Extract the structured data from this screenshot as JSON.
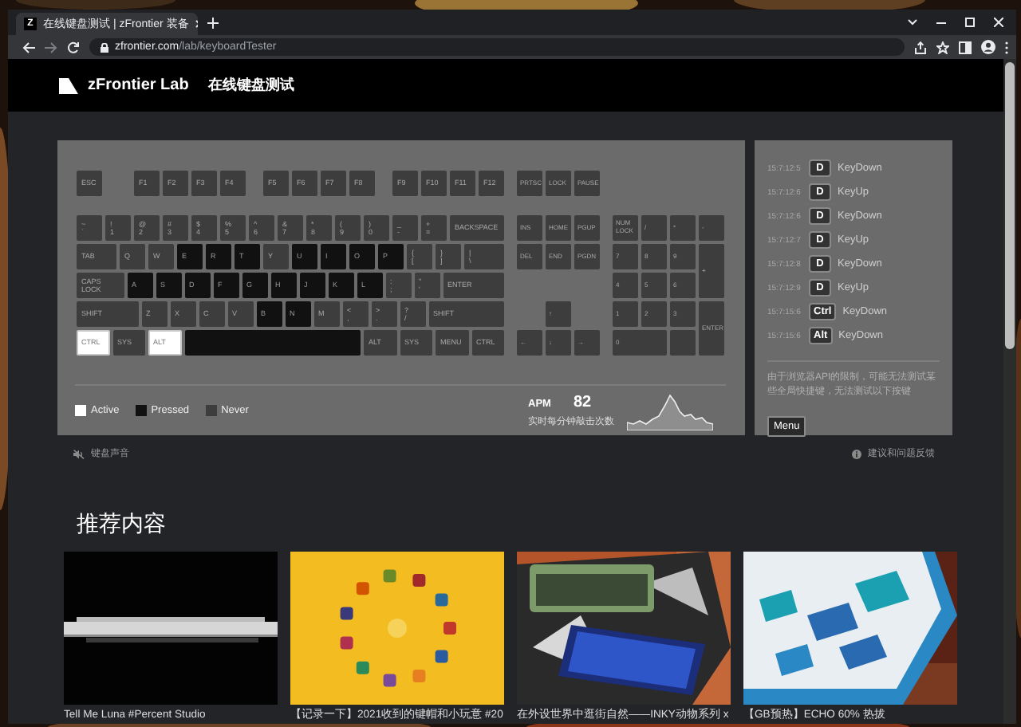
{
  "browser": {
    "favicon": "Z",
    "tab_title": "在线键盘测试 | zFrontier 装备",
    "url_domain": "zfrontier.com",
    "url_path": "/lab/keyboardTester"
  },
  "header": {
    "brand": "zFrontier Lab",
    "title": "在线键盘测试"
  },
  "keyboard": {
    "function_row": [
      {
        "label": "ESC",
        "active": false,
        "pressed": false
      },
      {
        "label": "F1",
        "active": false,
        "pressed": false
      },
      {
        "label": "F2",
        "active": false,
        "pressed": false
      },
      {
        "label": "F3",
        "active": false,
        "pressed": false
      },
      {
        "label": "F4",
        "active": false,
        "pressed": false
      },
      {
        "label": "F5",
        "active": false,
        "pressed": false
      },
      {
        "label": "F6",
        "active": false,
        "pressed": false
      },
      {
        "label": "F7",
        "active": false,
        "pressed": false
      },
      {
        "label": "F8",
        "active": false,
        "pressed": false
      },
      {
        "label": "F9",
        "active": false,
        "pressed": false
      },
      {
        "label": "F10",
        "active": false,
        "pressed": false
      },
      {
        "label": "F11",
        "active": false,
        "pressed": false
      },
      {
        "label": "F12",
        "active": false,
        "pressed": false
      }
    ],
    "system_keys": [
      {
        "label": "PRTSC",
        "active": false,
        "pressed": false
      },
      {
        "label": "LOCK",
        "active": false,
        "pressed": false
      },
      {
        "label": "PAUSE",
        "active": false,
        "pressed": false
      }
    ],
    "main_rows": [
      [
        {
          "label": "~\n`",
          "active": false,
          "pressed": false
        },
        {
          "label": "!\n1",
          "active": false,
          "pressed": false
        },
        {
          "label": "@\n2",
          "active": false,
          "pressed": false
        },
        {
          "label": "#\n3",
          "active": false,
          "pressed": false
        },
        {
          "label": "$\n4",
          "active": false,
          "pressed": false
        },
        {
          "label": "%\n5",
          "active": false,
          "pressed": false
        },
        {
          "label": "^\n6",
          "active": false,
          "pressed": false
        },
        {
          "label": "&\n7",
          "active": false,
          "pressed": false
        },
        {
          "label": "*\n8",
          "active": false,
          "pressed": false
        },
        {
          "label": "(\n9",
          "active": false,
          "pressed": false
        },
        {
          "label": ")\n0",
          "active": false,
          "pressed": false
        },
        {
          "label": "_\n-",
          "active": false,
          "pressed": false
        },
        {
          "label": "+\n=",
          "active": false,
          "pressed": false
        },
        {
          "label": "BACKSPACE",
          "active": false,
          "pressed": false
        }
      ],
      [
        {
          "label": "TAB",
          "active": false,
          "pressed": false
        },
        {
          "label": "Q",
          "active": false,
          "pressed": false
        },
        {
          "label": "W",
          "active": false,
          "pressed": false
        },
        {
          "label": "E",
          "active": false,
          "pressed": true
        },
        {
          "label": "R",
          "active": false,
          "pressed": true
        },
        {
          "label": "T",
          "active": false,
          "pressed": true
        },
        {
          "label": "Y",
          "active": false,
          "pressed": false
        },
        {
          "label": "U",
          "active": false,
          "pressed": true
        },
        {
          "label": "I",
          "active": false,
          "pressed": true
        },
        {
          "label": "O",
          "active": false,
          "pressed": true
        },
        {
          "label": "P",
          "active": false,
          "pressed": true
        },
        {
          "label": "{\n[",
          "active": false,
          "pressed": false
        },
        {
          "label": "}\n]",
          "active": false,
          "pressed": false
        },
        {
          "label": "|\n\\",
          "active": false,
          "pressed": false
        }
      ],
      [
        {
          "label": "CAPS LOCK",
          "active": false,
          "pressed": false
        },
        {
          "label": "A",
          "active": false,
          "pressed": true
        },
        {
          "label": "S",
          "active": false,
          "pressed": true
        },
        {
          "label": "D",
          "active": false,
          "pressed": true
        },
        {
          "label": "F",
          "active": false,
          "pressed": true
        },
        {
          "label": "G",
          "active": false,
          "pressed": true
        },
        {
          "label": "H",
          "active": false,
          "pressed": true
        },
        {
          "label": "J",
          "active": false,
          "pressed": true
        },
        {
          "label": "K",
          "active": false,
          "pressed": true
        },
        {
          "label": "L",
          "active": false,
          "pressed": true
        },
        {
          "label": ":\n;",
          "active": false,
          "pressed": false
        },
        {
          "label": "\"\n'",
          "active": false,
          "pressed": false
        },
        {
          "label": "ENTER",
          "active": false,
          "pressed": false
        }
      ],
      [
        {
          "label": "SHIFT",
          "active": false,
          "pressed": false
        },
        {
          "label": "Z",
          "active": false,
          "pressed": false
        },
        {
          "label": "X",
          "active": false,
          "pressed": false
        },
        {
          "label": "C",
          "active": false,
          "pressed": false
        },
        {
          "label": "V",
          "active": false,
          "pressed": false
        },
        {
          "label": "B",
          "active": false,
          "pressed": true
        },
        {
          "label": "N",
          "active": false,
          "pressed": true
        },
        {
          "label": "M",
          "active": false,
          "pressed": false
        },
        {
          "label": "<\n,",
          "active": false,
          "pressed": false
        },
        {
          "label": ">\n.",
          "active": false,
          "pressed": false
        },
        {
          "label": "?\n/",
          "active": false,
          "pressed": false
        },
        {
          "label": "SHIFT",
          "active": false,
          "pressed": false
        }
      ],
      [
        {
          "label": "CTRL",
          "active": true,
          "pressed": false
        },
        {
          "label": "SYS",
          "active": false,
          "pressed": false
        },
        {
          "label": "ALT",
          "active": true,
          "pressed": false
        },
        {
          "active": false,
          "pressed": true
        },
        {
          "label": "ALT",
          "active": false,
          "pressed": false
        },
        {
          "label": "SYS",
          "active": false,
          "pressed": false
        },
        {
          "label": "MENU",
          "active": false,
          "pressed": false
        },
        {
          "label": "CTRL",
          "active": false,
          "pressed": false
        }
      ]
    ],
    "nav_keys": [
      {
        "label": "INS",
        "active": false,
        "pressed": false
      },
      {
        "label": "HOME",
        "active": false,
        "pressed": false
      },
      {
        "label": "PGUP",
        "active": false,
        "pressed": false
      },
      {
        "label": "DEL",
        "active": false,
        "pressed": false
      },
      {
        "label": "END",
        "active": false,
        "pressed": false
      },
      {
        "label": "PGDN",
        "active": false,
        "pressed": false
      },
      {
        "label": "↑",
        "active": false,
        "pressed": false
      },
      {
        "label": "←",
        "active": false,
        "pressed": false
      },
      {
        "label": "↓",
        "active": false,
        "pressed": false
      },
      {
        "label": "→",
        "active": false,
        "pressed": false
      }
    ],
    "numpad": [
      {
        "label": "NUM\nLOCK",
        "active": false,
        "pressed": false
      },
      {
        "label": "/",
        "active": false,
        "pressed": false
      },
      {
        "label": "*",
        "active": false,
        "pressed": false
      },
      {
        "label": "-",
        "active": false,
        "pressed": false
      },
      {
        "label": "7",
        "active": false,
        "pressed": false
      },
      {
        "label": "8",
        "active": false,
        "pressed": false
      },
      {
        "label": "9",
        "active": false,
        "pressed": false
      },
      {
        "label": "+",
        "active": false,
        "pressed": false
      },
      {
        "label": "4",
        "active": false,
        "pressed": false
      },
      {
        "label": "5",
        "active": false,
        "pressed": false
      },
      {
        "label": "6",
        "active": false,
        "pressed": false
      },
      {
        "label": "1",
        "active": false,
        "pressed": false
      },
      {
        "label": "2",
        "active": false,
        "pressed": false
      },
      {
        "label": "3",
        "active": false,
        "pressed": false
      },
      {
        "label": "ENTER",
        "active": false,
        "pressed": false
      },
      {
        "label": "0",
        "active": false,
        "pressed": false
      },
      {
        "active": false,
        "pressed": false
      }
    ],
    "legend": [
      {
        "label": "Active",
        "color": "#ffffff"
      },
      {
        "label": "Pressed",
        "color": "#111111"
      },
      {
        "label": "Never",
        "color": "#3d3d3d"
      }
    ],
    "apm": {
      "label": "APM",
      "value": "82",
      "caption": "实时每分钟敲击次数"
    }
  },
  "log": {
    "entries": [
      {
        "time": "15:7:12:5",
        "key": "D",
        "event": "KeyDown"
      },
      {
        "time": "15:7:12:6",
        "key": "D",
        "event": "KeyUp"
      },
      {
        "time": "15:7:12:6",
        "key": "D",
        "event": "KeyDown"
      },
      {
        "time": "15:7:12:7",
        "key": "D",
        "event": "KeyUp"
      },
      {
        "time": "15:7:12:8",
        "key": "D",
        "event": "KeyDown"
      },
      {
        "time": "15:7:12:9",
        "key": "D",
        "event": "KeyUp"
      },
      {
        "time": "15:7:15:6",
        "key": "Ctrl",
        "event": "KeyDown"
      },
      {
        "time": "15:7:15:6",
        "key": "Alt",
        "event": "KeyDown"
      }
    ],
    "note": "由于浏览器API的限制，可能无法测试某些全局快捷键，无法测试以下按键",
    "button": "Menu"
  },
  "footer": {
    "sound": "键盘声音",
    "feedback": "建议和问题反馈"
  },
  "recommend": {
    "heading": "推荐内容",
    "cards": [
      {
        "caption": "Tell Me Luna #Percent Studio"
      },
      {
        "caption": "【记录一下】2021收到的键帽和小玩意 #20"
      },
      {
        "caption": "在外设世界中逛街自然——INKY动物系列 x"
      },
      {
        "caption": "【GB预热】ECHO 60% 热拔"
      }
    ]
  }
}
